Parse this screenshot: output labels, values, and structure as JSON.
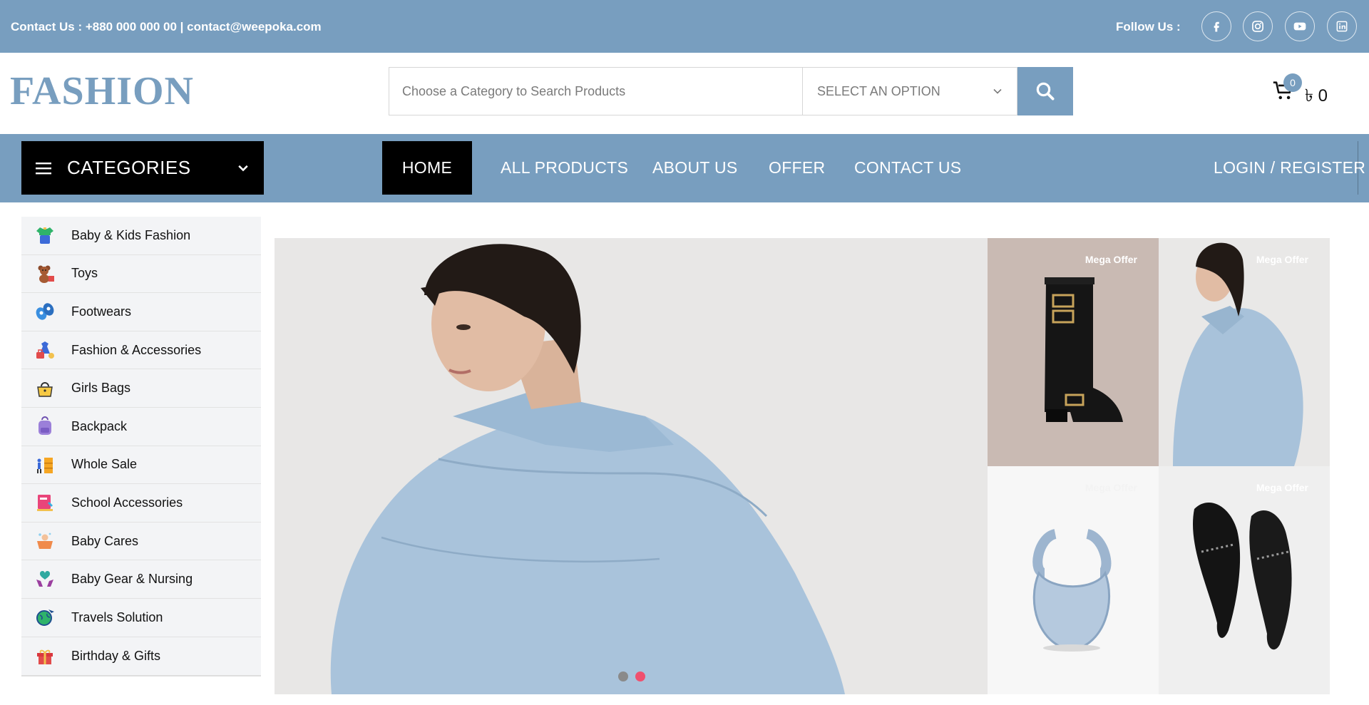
{
  "topbar": {
    "contact_text": "Contact Us : +880 000 000 00 |  contact@weepoka.com",
    "follow_label": "Follow Us :",
    "social": [
      {
        "icon": "facebook-icon"
      },
      {
        "icon": "instagram-icon"
      },
      {
        "icon": "youtube-icon"
      },
      {
        "icon": "linkedin-icon"
      }
    ]
  },
  "header": {
    "logo": "FASHION",
    "search_placeholder": "Choose a Category to Search Products",
    "select_value": "SELECT AN OPTION",
    "cart_count": "0",
    "cart_total": "৳ 0"
  },
  "nav": {
    "categories_label": "CATEGORIES",
    "links": [
      "HOME",
      "ALL PRODUCTS",
      "ABOUT US",
      "OFFER",
      "CONTACT US"
    ],
    "login_label": "LOGIN / REGISTER"
  },
  "sidebar": {
    "items": [
      {
        "label": "Baby & Kids Fashion",
        "icon": "kids-clothes-icon"
      },
      {
        "label": "Toys",
        "icon": "teddy-bear-icon"
      },
      {
        "label": "Footwears",
        "icon": "baby-shoes-icon"
      },
      {
        "label": "Fashion & Accessories",
        "icon": "clothing-accessories-icon"
      },
      {
        "label": "Girls Bags",
        "icon": "handbag-icon"
      },
      {
        "label": "Backpack",
        "icon": "backpack-icon"
      },
      {
        "label": "Whole Sale",
        "icon": "wholesale-icon"
      },
      {
        "label": "School Accessories",
        "icon": "school-books-icon"
      },
      {
        "label": "Baby Cares",
        "icon": "baby-bath-icon"
      },
      {
        "label": "Baby Gear & Nursing",
        "icon": "care-hands-icon"
      },
      {
        "label": "Travels Solution",
        "icon": "travel-globe-icon"
      },
      {
        "label": "Birthday & Gifts",
        "icon": "gift-box-icon"
      }
    ]
  },
  "promos": [
    {
      "label": "Mega Offer"
    },
    {
      "label": "Mega Offer"
    },
    {
      "label": "Mega Offer"
    },
    {
      "label": "Mega Offer"
    }
  ],
  "colors": {
    "brand": "#789ebf",
    "nav_active": "#000000",
    "slider_dot_active": "#f0506e",
    "slider_dot": "#8a8a8a"
  }
}
